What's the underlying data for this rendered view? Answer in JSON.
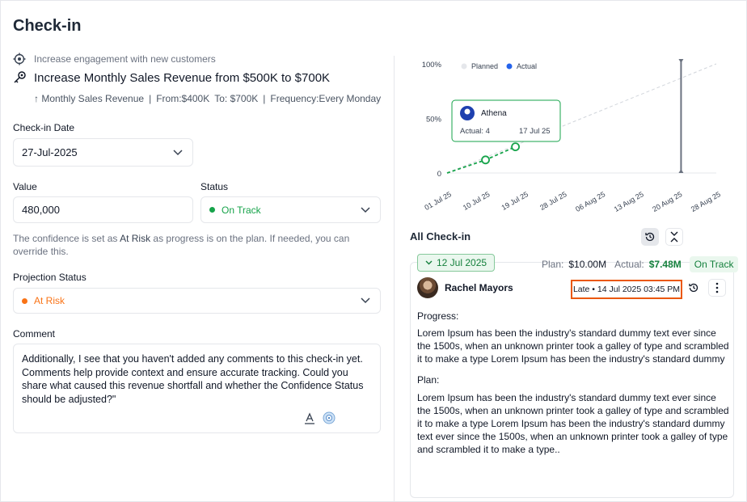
{
  "page": {
    "title": "Check-in"
  },
  "objective": {
    "text": "Increase engagement with new customers",
    "icon": "target-icon"
  },
  "key_result": {
    "title": "Increase Monthly Sales Revenue from $500K to $700K",
    "icon": "key-result-icon",
    "metric": "↑ Monthly Sales Revenue",
    "from": "From:$400K",
    "to": "To: $700K",
    "frequency": "Frequency:Every Monday",
    "separator": "|"
  },
  "form": {
    "date_label": "Check-in Date",
    "date_value": "27-Jul-2025",
    "value_label": "Value",
    "value": "480,000",
    "status_label": "Status",
    "status_value": "On Track",
    "status_color": "#16a34a",
    "confidence_note_pre": "The confidence is set as ",
    "confidence_note_bold": "At Risk",
    "confidence_note_post": " as progress is on the plan. If needed, you can override this.",
    "projection_label": "Projection Status",
    "projection_value": "At Risk",
    "projection_color": "#f97316",
    "comment_label": "Comment",
    "comment_text": "Additionally, I see that you haven't added any comments to this check-in yet. Comments help provide context and ensure accurate tracking. Could you share what caused this revenue shortfall and whether the Confidence Status should be adjusted?\""
  },
  "chart_data": {
    "type": "line",
    "y_ticks": [
      "100%",
      "50%",
      "0"
    ],
    "ylim": [
      0,
      100
    ],
    "x_ticks": [
      "01 Jul 25",
      "10 Jul 25",
      "19 Jul 25",
      "28 Jul 25",
      "06 Aug 25",
      "13 Aug 25",
      "20 Aug 25",
      "28 Aug 25"
    ],
    "legend": [
      "Planned",
      "Actual"
    ],
    "legend_placement": "top",
    "series": [
      {
        "name": "Planned",
        "color": "#d1d5db",
        "x": [
          "01 Jul 25",
          "28 Aug 25"
        ],
        "values": [
          0,
          100
        ]
      },
      {
        "name": "Actual",
        "color": "#16a34a",
        "x": [
          "01 Jul 25",
          "10 Jul 25",
          "17 Jul 25"
        ],
        "values": [
          0,
          12,
          24
        ]
      }
    ],
    "marker_x": "20 Aug 25",
    "tooltip": {
      "name": "Athena",
      "label": "Actual: 4",
      "date": "17 Jul 25"
    }
  },
  "checkins": {
    "title": "All Check-in",
    "date_chip": "12 Jul 2025",
    "plan_label": "Plan:",
    "plan_value": "$10.00M",
    "actual_label": "Actual:",
    "actual_value": "$7.48M",
    "status": "On Track",
    "person": "Rachel Mayors",
    "late_text": "Late • 14 Jul 2025 03:45 PM",
    "progress_label": "Progress:",
    "progress_text": "Lorem Ipsum has been the industry's standard dummy text ever since the 1500s, when an unknown printer took a galley of type and scrambled it to make a type Lorem Ipsum has been the industry's standard dummy",
    "plan_section_label": "Plan:",
    "plan_text": "Lorem Ipsum has been the industry's standard dummy text ever since the 1500s, when an unknown printer took a galley of type and scrambled it to make a type Lorem Ipsum has been the industry's standard dummy text ever since the 1500s, when an unknown printer took a galley of type and scrambled it to make a type.."
  }
}
